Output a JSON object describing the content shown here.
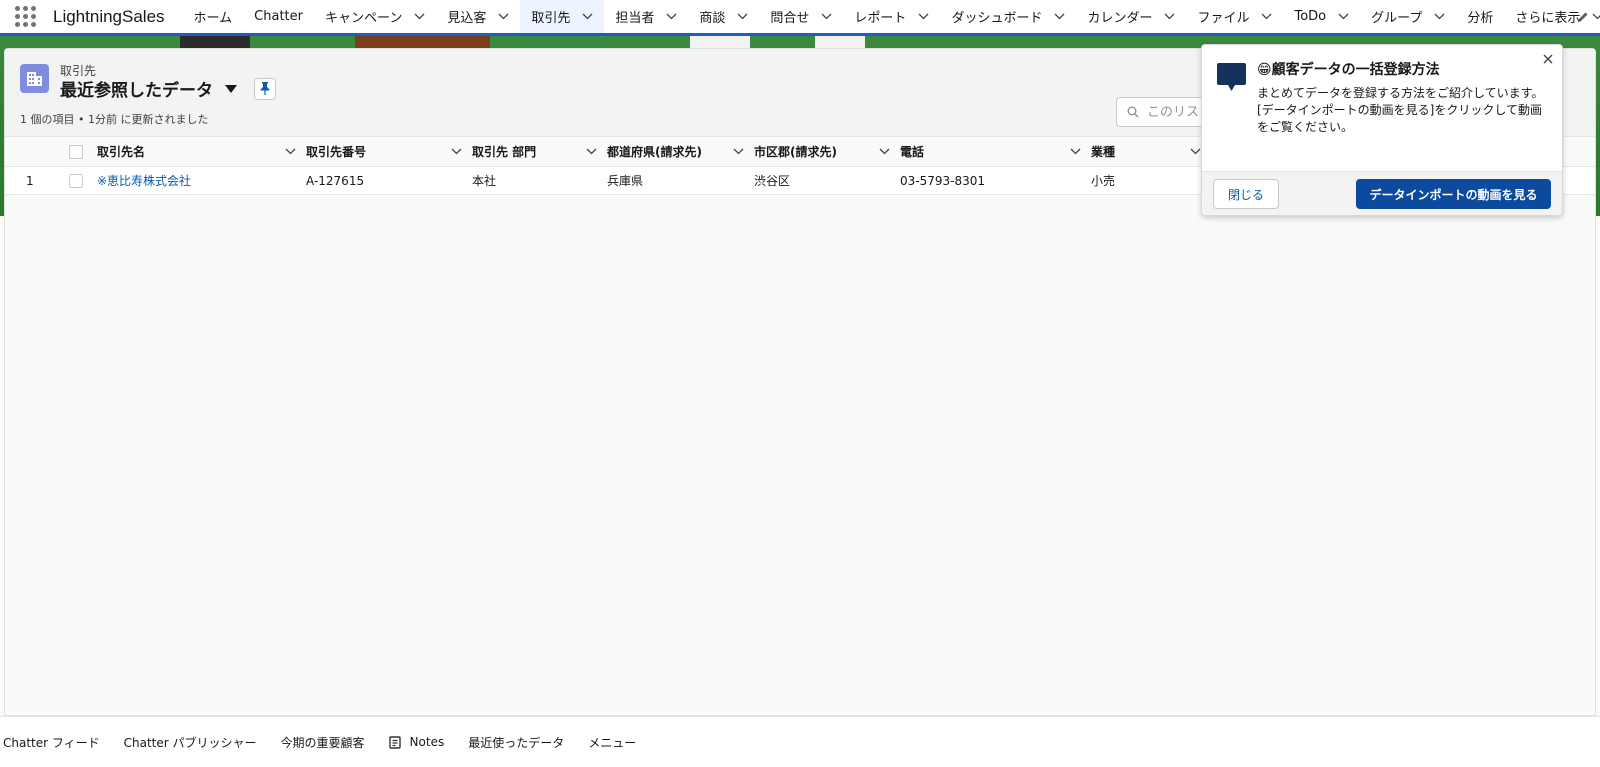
{
  "app": {
    "name": "LightningSales"
  },
  "nav": {
    "items": [
      {
        "label": "ホーム",
        "has_menu": false,
        "active": false
      },
      {
        "label": "Chatter",
        "has_menu": false,
        "active": false
      },
      {
        "label": "キャンペーン",
        "has_menu": true,
        "active": false
      },
      {
        "label": "見込客",
        "has_menu": true,
        "active": false
      },
      {
        "label": "取引先",
        "has_menu": true,
        "active": true
      },
      {
        "label": "担当者",
        "has_menu": true,
        "active": false
      },
      {
        "label": "商談",
        "has_menu": true,
        "active": false
      },
      {
        "label": "問合せ",
        "has_menu": true,
        "active": false
      },
      {
        "label": "レポート",
        "has_menu": true,
        "active": false
      },
      {
        "label": "ダッシュボード",
        "has_menu": true,
        "active": false
      },
      {
        "label": "カレンダー",
        "has_menu": true,
        "active": false
      },
      {
        "label": "ファイル",
        "has_menu": true,
        "active": false
      },
      {
        "label": "ToDo",
        "has_menu": true,
        "active": false
      },
      {
        "label": "グループ",
        "has_menu": true,
        "active": false
      },
      {
        "label": "分析",
        "has_menu": false,
        "active": false
      },
      {
        "label": "さらに表示",
        "has_menu": true,
        "active": false
      }
    ]
  },
  "list_view": {
    "object_label": "取引先",
    "title": "最近参照したデータ",
    "status": "1 個の項目 • 1分前 に更新されました",
    "search_placeholder": "このリストを検索..."
  },
  "table": {
    "columns": [
      "取引先名",
      "取引先番号",
      "取引先 部門",
      "都道府県(請求先)",
      "市区郡(請求先)",
      "電話",
      "業種"
    ],
    "rows": [
      {
        "num": "1",
        "name": "※恵比寿株式会社",
        "number": "A-127615",
        "site": "本社",
        "state": "兵庫県",
        "city": "渋谷区",
        "phone": "03-5793-8301",
        "industry": "小売"
      }
    ]
  },
  "popover": {
    "title": "😁顧客データの一括登録方法",
    "body": "まとめてデータを登録する方法をご紹介しています。[データインポートの動画を見る]をクリックして動画をご覧ください。",
    "close_label": "閉じる",
    "action_label": "データインポートの動画を見る"
  },
  "utility_bar": {
    "items": [
      {
        "label": "Chatter フィード",
        "icon": null
      },
      {
        "label": "Chatter パブリッシャー",
        "icon": null
      },
      {
        "label": "今期の重要顧客",
        "icon": null
      },
      {
        "label": "Notes",
        "icon": "notes-icon"
      },
      {
        "label": "最近使ったデータ",
        "icon": null
      },
      {
        "label": "メニュー",
        "icon": null
      }
    ]
  },
  "colors": {
    "brand": "#1b5fc1",
    "link": "#0b5cab",
    "brand_button": "#0b4a9e",
    "object_icon": "#7f8de1",
    "hero_green": "#2f7e34"
  }
}
